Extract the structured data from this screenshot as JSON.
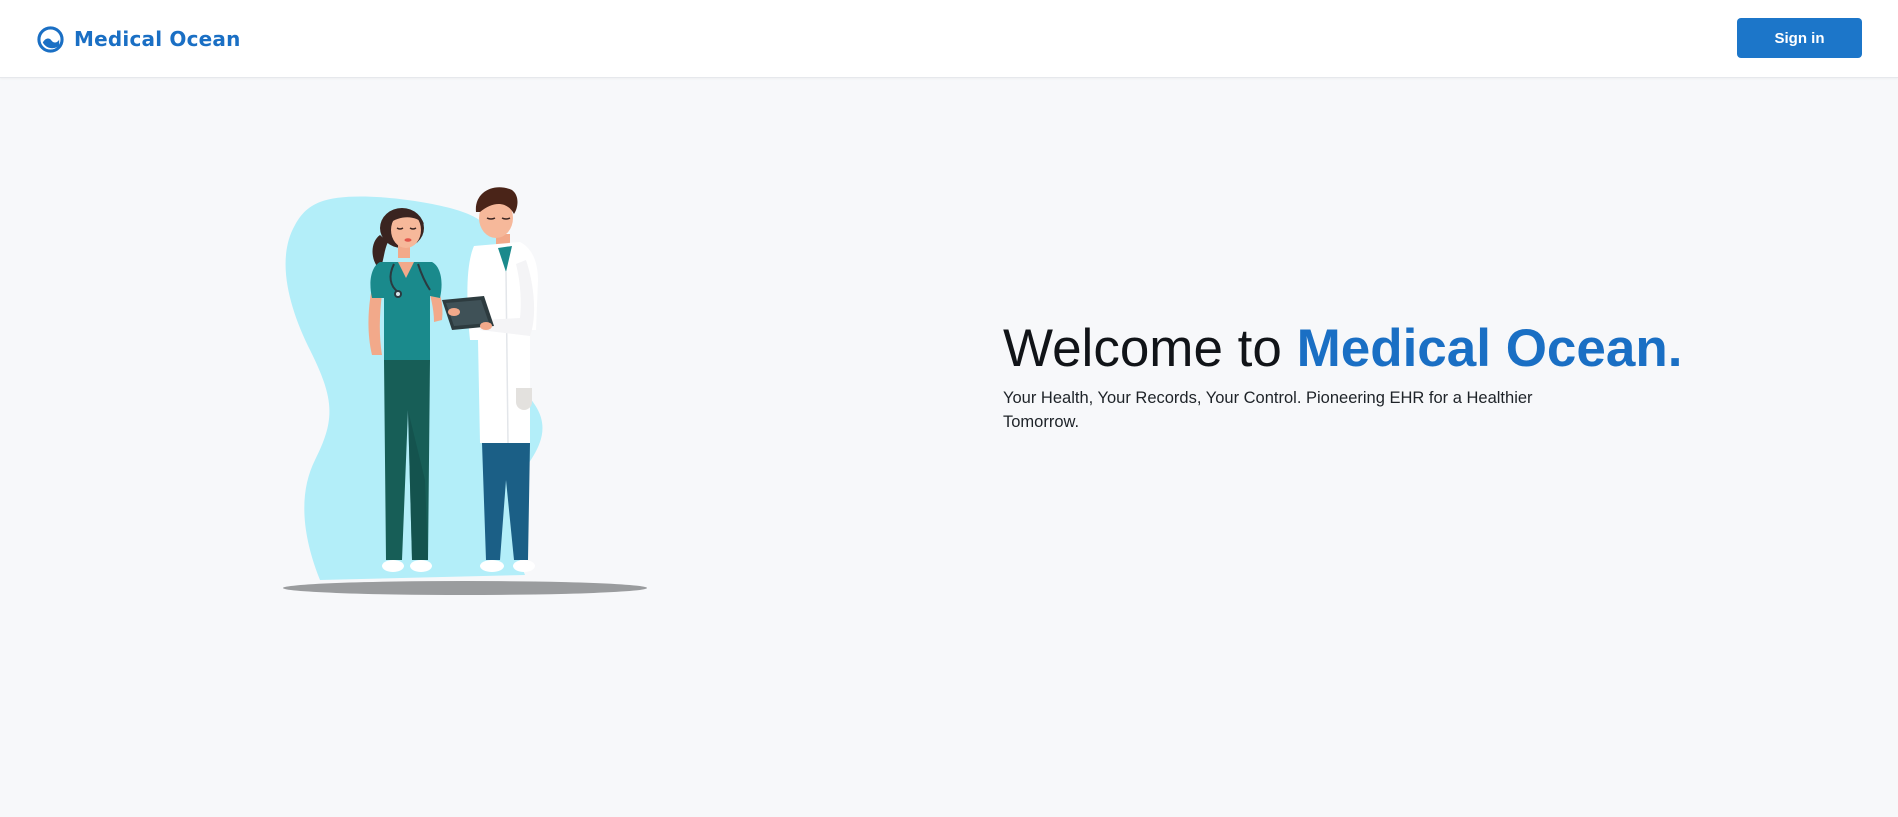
{
  "header": {
    "brand_name": "Medical Ocean",
    "brand_icon": "medical-ocean-logo-icon",
    "signin_label": "Sign in"
  },
  "hero": {
    "title_prefix": "Welcome to ",
    "title_accent": "Medical Ocean.",
    "subtitle": "Your Health, Your Records, Your Control. Pioneering EHR for a Healthier Tomorrow.",
    "illustration": "nurse-and-doctor-illustration"
  },
  "colors": {
    "brand": "#1a6fc4",
    "button": "#1c76c9",
    "page_background": "#f7f8fa",
    "header_background": "#ffffff",
    "illustration_blob": "#b3eef9",
    "scrubs": "#1a8a8c",
    "coat": "#ffffff"
  }
}
